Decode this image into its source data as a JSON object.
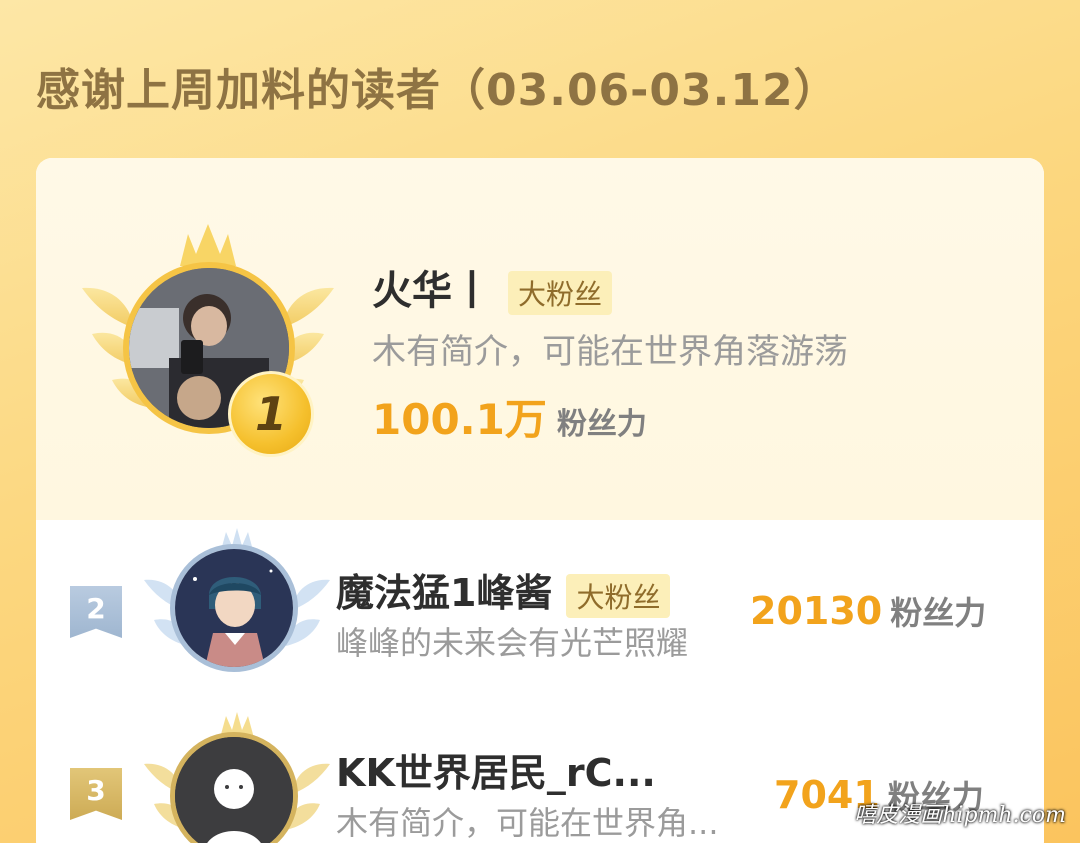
{
  "header": {
    "title": "感谢上周加料的读者（03.06-03.12）"
  },
  "leaderboard": [
    {
      "rank": "1",
      "name": "火华丨",
      "tag": "大粉丝",
      "bio": "木有简介，可能在世界角落游荡",
      "power_value": "100.1万",
      "power_label": "粉丝力"
    },
    {
      "rank": "2",
      "name": "魔法猛1峰酱",
      "tag": "大粉丝",
      "bio": "峰峰的未来会有光芒照耀",
      "power_value": "20130",
      "power_label": "粉丝力"
    },
    {
      "rank": "3",
      "name": "KK世界居民_rC...",
      "tag": "",
      "bio": "木有简介，可能在世界角...",
      "power_value": "7041",
      "power_label": "粉丝力"
    }
  ],
  "watermark": "嘻皮漫画hipmh.com",
  "colors": {
    "gold": "#f5c445",
    "accent_orange": "#f2a31c",
    "tag_bg": "#fcefb9",
    "silver": "#a9bfd8",
    "bronze": "#d4b35e"
  }
}
